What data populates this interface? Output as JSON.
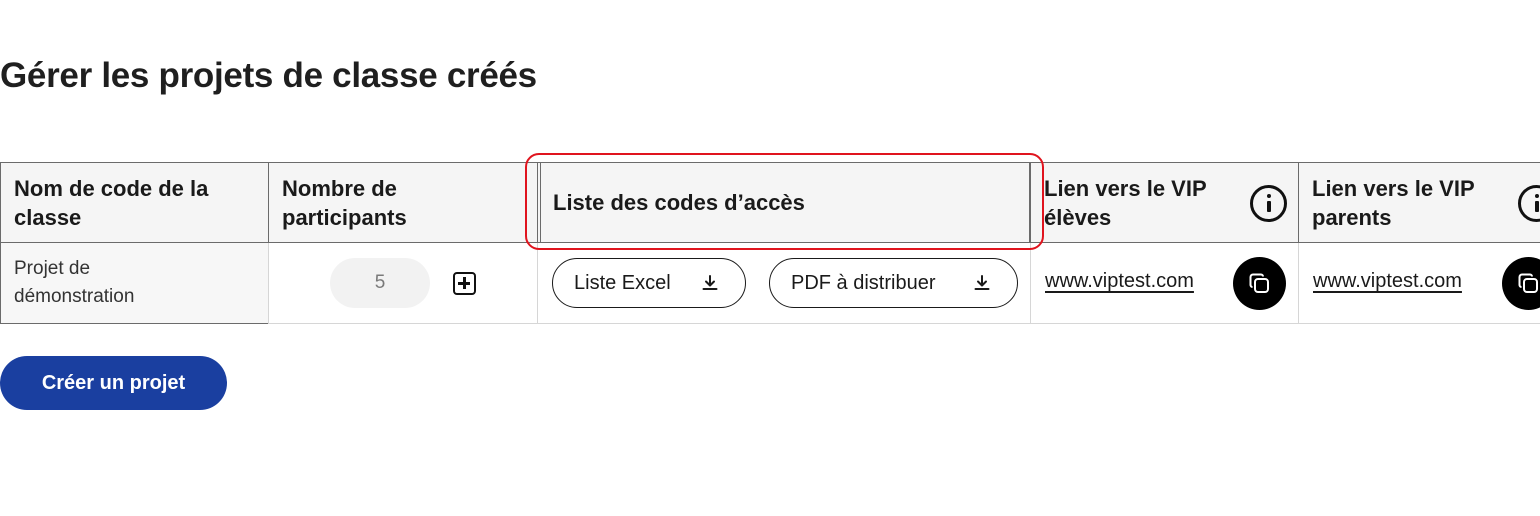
{
  "page": {
    "title": "Gérer les projets de classe créés"
  },
  "table": {
    "headers": {
      "class_code": "Nom de code de la classe",
      "participants": "Nombre de participants",
      "access_codes": "Liste des codes d’accès",
      "vip_students": "Lien vers le VIP élèves",
      "vip_parents": "Lien vers le VIP parents"
    },
    "rows": [
      {
        "class_code": "Projet de démonstration",
        "participants": "5",
        "excel_label": "Liste Excel",
        "pdf_label": "PDF à distribuer",
        "vip_students_link": "www.viptest.com",
        "vip_parents_link": "www.viptest.com"
      }
    ]
  },
  "icons": {
    "info": "info-icon",
    "add": "plus-square-icon",
    "download": "download-icon",
    "copy": "copy-icon"
  },
  "actions": {
    "create_project": "Créer un projet"
  },
  "colors": {
    "primary": "#1a3fa0",
    "highlight": "#e0141e",
    "header_bg": "#f5f5f5"
  }
}
